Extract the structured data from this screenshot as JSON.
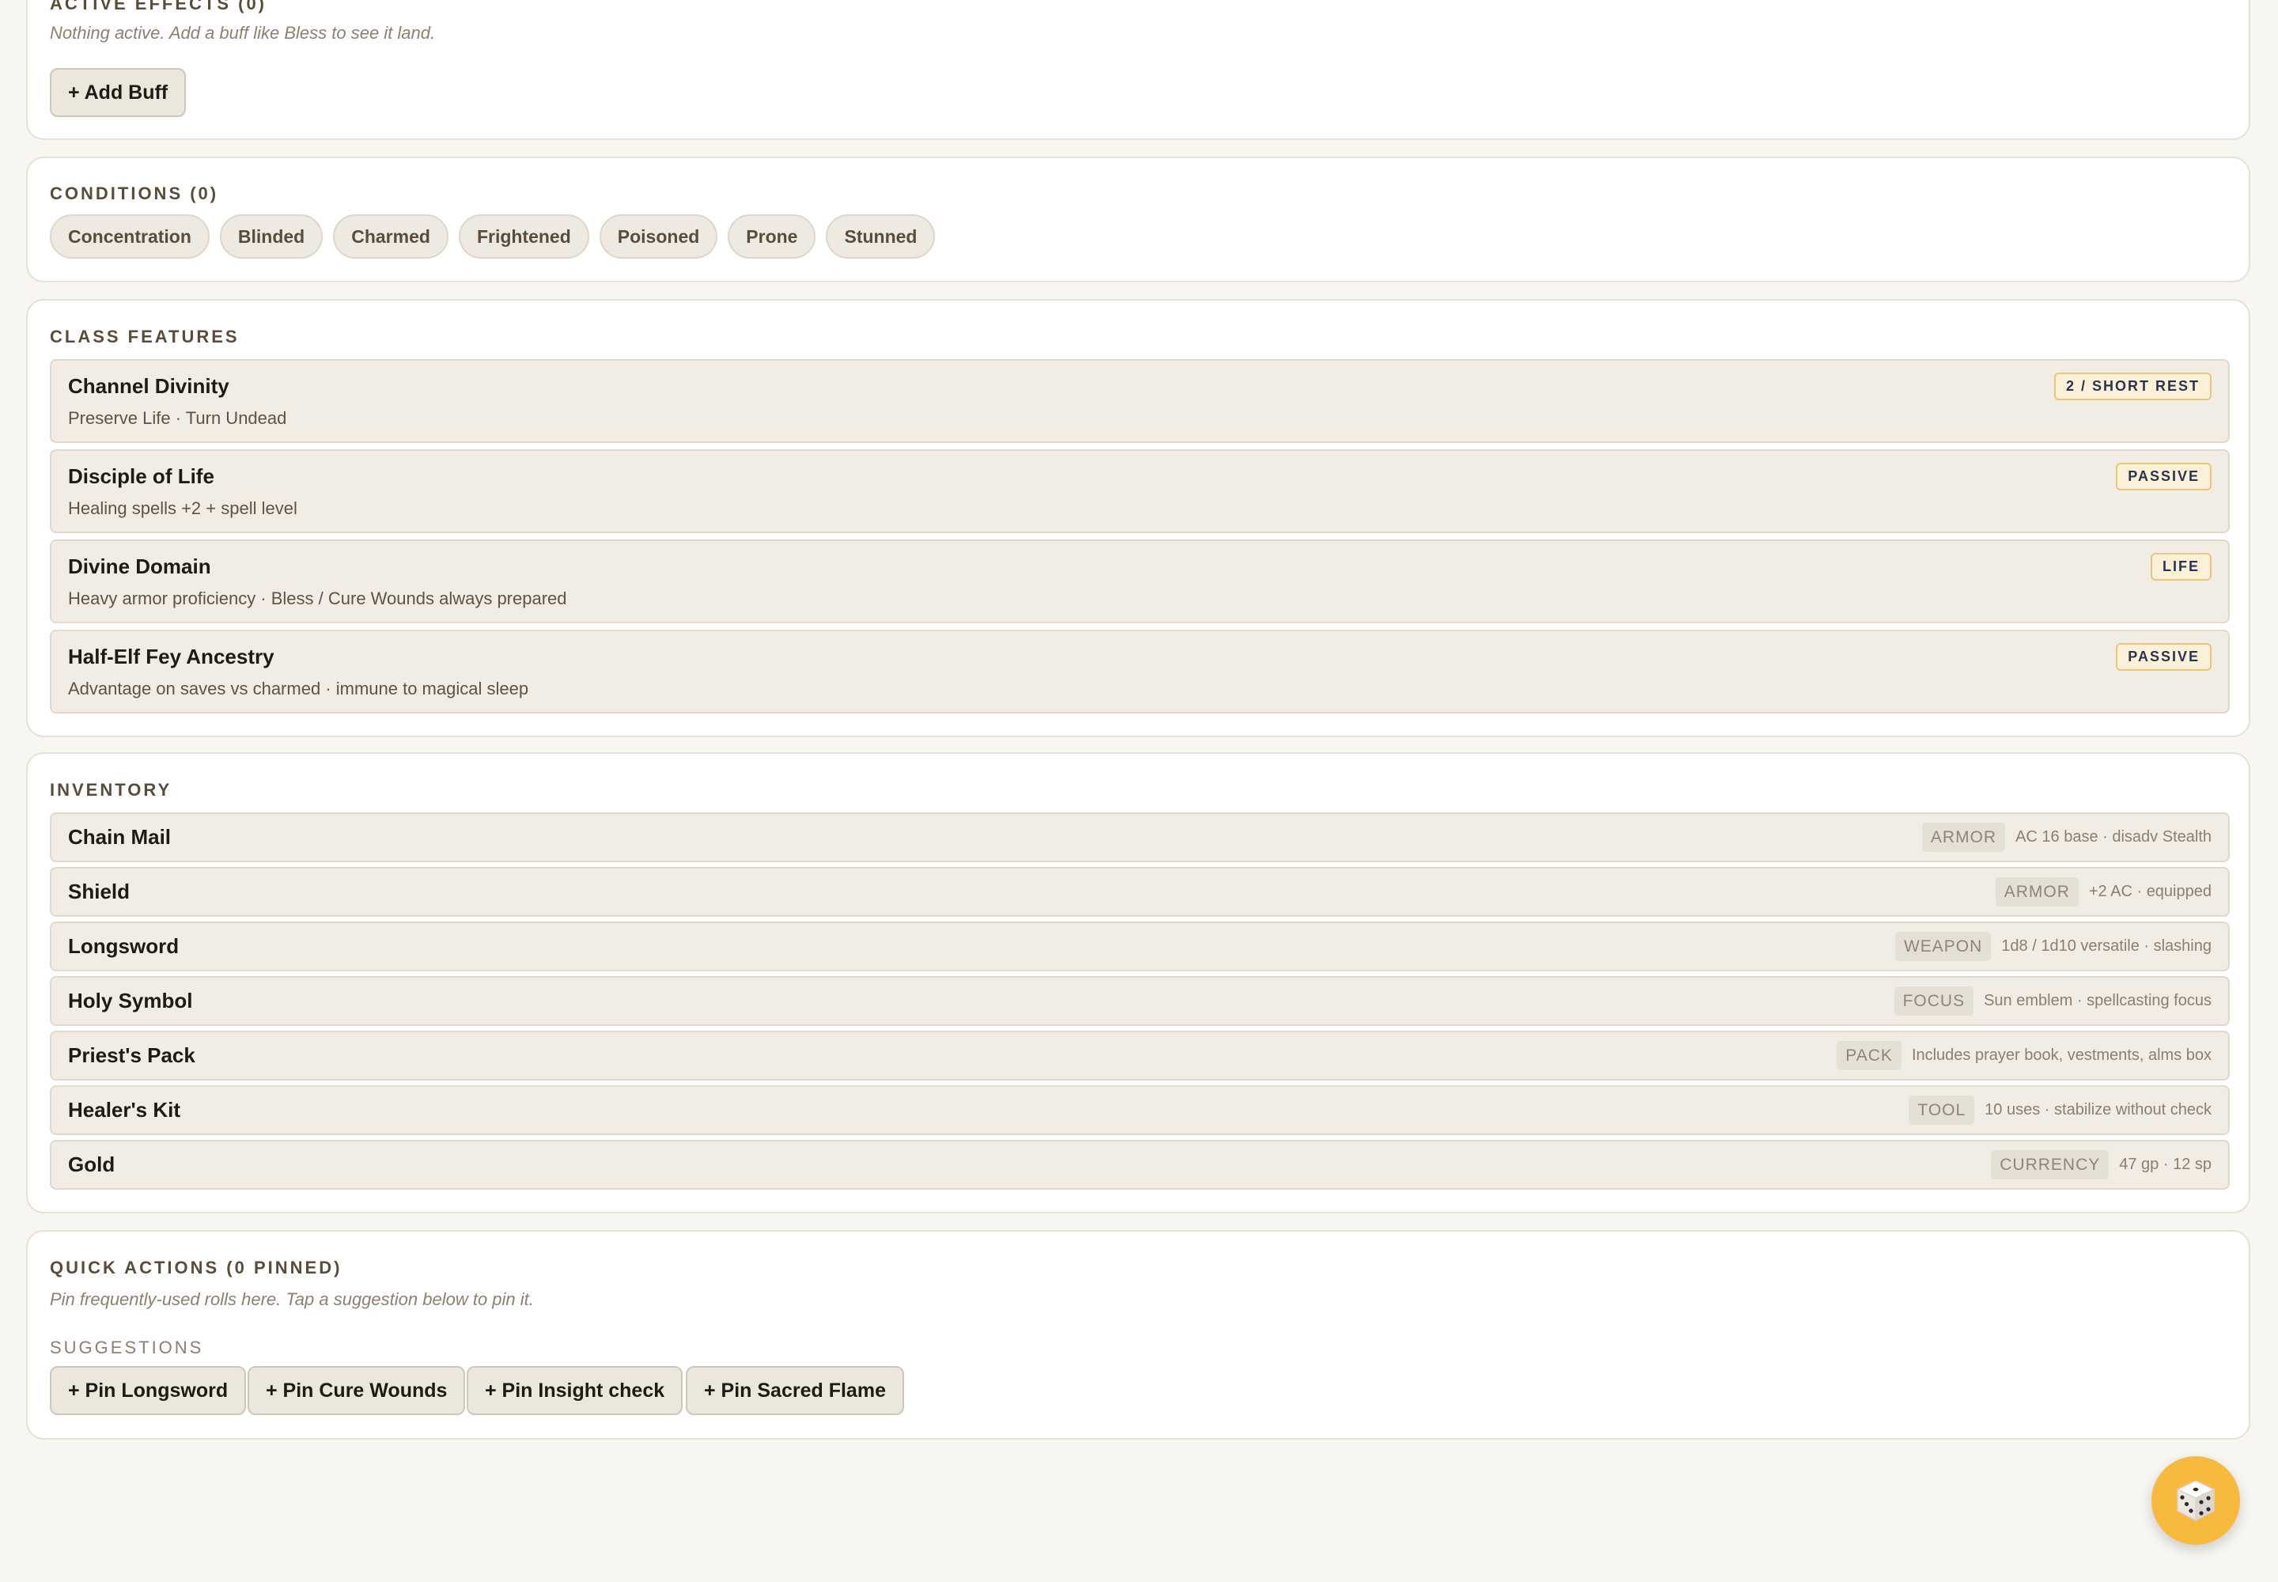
{
  "active_effects": {
    "title": "Active Effects (0)",
    "empty_text": "Nothing active. Add a buff like Bless to see it land.",
    "add_button": "+ Add Buff"
  },
  "conditions": {
    "title": "Conditions (0)",
    "items": [
      "Concentration",
      "Blinded",
      "Charmed",
      "Frightened",
      "Poisoned",
      "Prone",
      "Stunned"
    ]
  },
  "class_features": {
    "title": "Class Features",
    "items": [
      {
        "name": "Channel Divinity",
        "desc": "Preserve Life · Turn Undead",
        "badge": "2 / SHORT REST"
      },
      {
        "name": "Disciple of Life",
        "desc": "Healing spells +2 + spell level",
        "badge": "PASSIVE"
      },
      {
        "name": "Divine Domain",
        "desc": "Heavy armor proficiency · Bless / Cure Wounds always prepared",
        "badge": "LIFE"
      },
      {
        "name": "Half-Elf Fey Ancestry",
        "desc": "Advantage on saves vs charmed · immune to magical sleep",
        "badge": "PASSIVE"
      }
    ]
  },
  "inventory": {
    "title": "Inventory",
    "items": [
      {
        "name": "Chain Mail",
        "tag": "ARMOR",
        "desc": "AC 16 base · disadv Stealth"
      },
      {
        "name": "Shield",
        "tag": "ARMOR",
        "desc": "+2 AC · equipped"
      },
      {
        "name": "Longsword",
        "tag": "WEAPON",
        "desc": "1d8 / 1d10 versatile · slashing"
      },
      {
        "name": "Holy Symbol",
        "tag": "FOCUS",
        "desc": "Sun emblem · spellcasting focus"
      },
      {
        "name": "Priest's Pack",
        "tag": "PACK",
        "desc": "Includes prayer book, vestments, alms box"
      },
      {
        "name": "Healer's Kit",
        "tag": "TOOL",
        "desc": "10 uses · stabilize without check"
      },
      {
        "name": "Gold",
        "tag": "CURRENCY",
        "desc": "47 gp · 12 sp"
      }
    ]
  },
  "quick_actions": {
    "title": "Quick Actions (0 Pinned)",
    "hint": "Pin frequently-used rolls here. Tap a suggestion below to pin it.",
    "suggestions_label": "SUGGESTIONS",
    "suggestions": [
      "+ Pin Longsword",
      "+ Pin Cure Wounds",
      "+ Pin Insight check",
      "+ Pin Sacred Flame"
    ]
  },
  "fab": {
    "icon": "dice-icon",
    "color": "#f7b93e"
  }
}
